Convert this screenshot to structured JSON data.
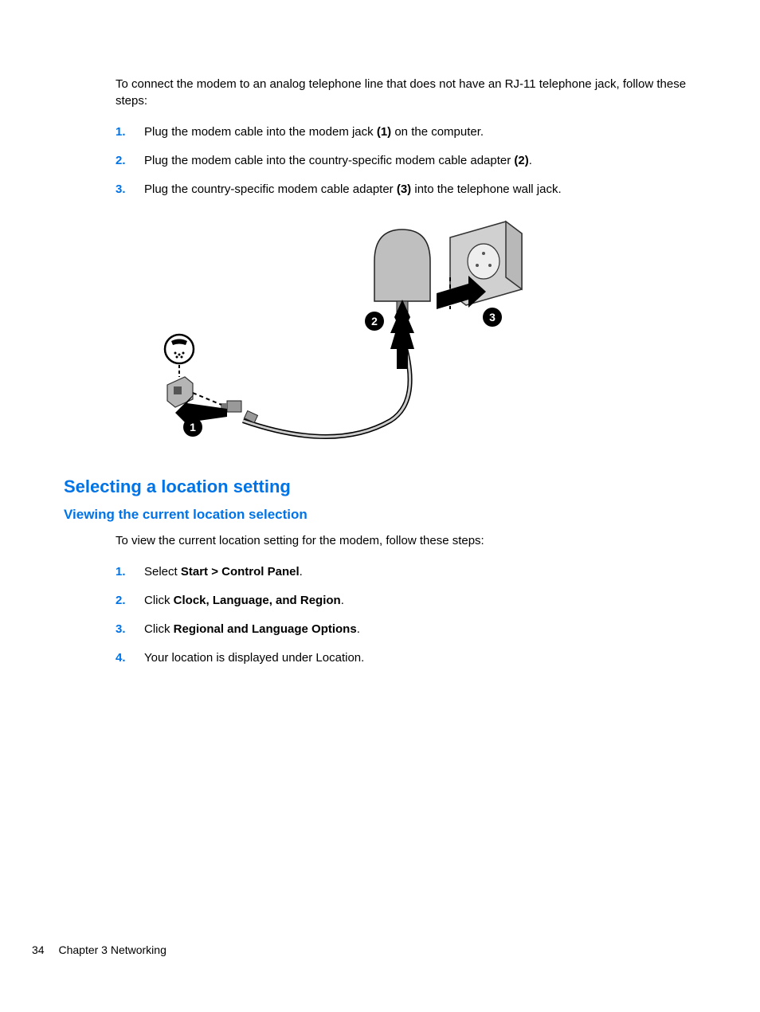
{
  "intro1": "To connect the modem to an analog telephone line that does not have an RJ-11 telephone jack, follow these steps:",
  "steps1": [
    {
      "num": "1.",
      "pre": "Plug the modem cable into the modem jack ",
      "bold": "(1)",
      "post": " on the computer."
    },
    {
      "num": "2.",
      "pre": "Plug the modem cable into the country-specific modem cable adapter ",
      "bold": "(2)",
      "post": "."
    },
    {
      "num": "3.",
      "pre": "Plug the country-specific modem cable adapter ",
      "bold": "(3)",
      "post": " into the telephone wall jack."
    }
  ],
  "h2": "Selecting a location setting",
  "h3": "Viewing the current location selection",
  "intro2": "To view the current location setting for the modem, follow these steps:",
  "steps2": [
    {
      "num": "1.",
      "pre": "Select ",
      "bold": "Start > Control Panel",
      "post": "."
    },
    {
      "num": "2.",
      "pre": "Click ",
      "bold": "Clock, Language, and Region",
      "post": "."
    },
    {
      "num": "3.",
      "pre": "Click ",
      "bold": "Regional and Language Options",
      "post": "."
    },
    {
      "num": "4.",
      "pre": "Your location is displayed under Location.",
      "bold": "",
      "post": ""
    }
  ],
  "footer": {
    "page": "34",
    "chapter": "Chapter 3   Networking"
  },
  "figure": {
    "callouts": [
      "1",
      "2",
      "3"
    ]
  }
}
